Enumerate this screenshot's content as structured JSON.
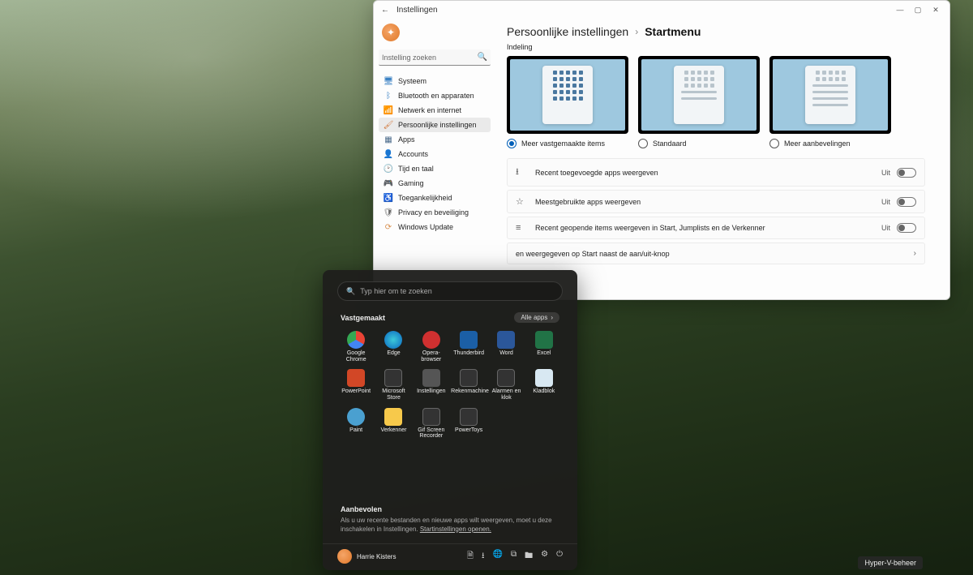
{
  "settings": {
    "back_icon": "←",
    "window_title": "Instellingen",
    "search_placeholder": "Instelling zoeken",
    "nav": [
      {
        "icon": "🖥",
        "label": "Systeem",
        "color": "#3b82c4"
      },
      {
        "icon": "ᛒ",
        "label": "Bluetooth en apparaten",
        "color": "#3b82c4"
      },
      {
        "icon": "📶",
        "label": "Netwerk en internet",
        "color": "#3bb0d4"
      },
      {
        "icon": "🖌",
        "label": "Persoonlijke instellingen",
        "color": "#d07030",
        "selected": true
      },
      {
        "icon": "▦",
        "label": "Apps",
        "color": "#4a6a8a"
      },
      {
        "icon": "👤",
        "label": "Accounts",
        "color": "#d89050"
      },
      {
        "icon": "🕑",
        "label": "Tijd en taal",
        "color": "#6a6a6a"
      },
      {
        "icon": "🎮",
        "label": "Gaming",
        "color": "#6a6a6a"
      },
      {
        "icon": "♿",
        "label": "Toegankelijkheid",
        "color": "#3b82c4"
      },
      {
        "icon": "🛡",
        "label": "Privacy en beveiliging",
        "color": "#6a6a6a"
      },
      {
        "icon": "⟳",
        "label": "Windows Update",
        "color": "#d89050"
      }
    ],
    "breadcrumb": {
      "parent": "Persoonlijke instellingen",
      "sep": "›",
      "current": "Startmenu"
    },
    "section_layout": "Indeling",
    "layout_options": [
      {
        "label": "Meer vastgemaakte items",
        "checked": true
      },
      {
        "label": "Standaard",
        "checked": false
      },
      {
        "label": "Meer aanbevelingen",
        "checked": false
      }
    ],
    "toggles": [
      {
        "icon": "⭳",
        "label": "Recent toegevoegde apps weergeven",
        "state": "Uit"
      },
      {
        "icon": "☆",
        "label": "Meestgebruikte apps weergeven",
        "state": "Uit"
      },
      {
        "icon": "≡",
        "label": "Recent geopende items weergeven in Start, Jumplists en de Verkenner",
        "state": "Uit"
      }
    ],
    "expand_row": "en weergegeven op Start naast de aan/uit-knop"
  },
  "start": {
    "search_placeholder": "Typ hier om te zoeken",
    "pinned_label": "Vastgemaakt",
    "all_apps": "Alle apps",
    "apps": [
      {
        "label": "Google Chrome",
        "cls": "ic-chrome"
      },
      {
        "label": "Edge",
        "cls": "ic-edge"
      },
      {
        "label": "Opera-browser",
        "cls": "ic-opera"
      },
      {
        "label": "Thunderbird",
        "cls": "ic-tbird"
      },
      {
        "label": "Word",
        "cls": "ic-word"
      },
      {
        "label": "Excel",
        "cls": "ic-excel"
      },
      {
        "label": "PowerPoint",
        "cls": "ic-ppt"
      },
      {
        "label": "Microsoft Store",
        "cls": "ic-store"
      },
      {
        "label": "Instellingen",
        "cls": "ic-settings"
      },
      {
        "label": "Rekenmachine",
        "cls": "ic-calc"
      },
      {
        "label": "Alarmen en klok",
        "cls": "ic-clock"
      },
      {
        "label": "Kladblok",
        "cls": "ic-notepad"
      },
      {
        "label": "Paint",
        "cls": "ic-paint"
      },
      {
        "label": "Verkenner",
        "cls": "ic-explorer"
      },
      {
        "label": "Gif Screen Recorder",
        "cls": "ic-gif"
      },
      {
        "label": "PowerToys",
        "cls": "ic-ptoys"
      }
    ],
    "recommended_label": "Aanbevolen",
    "recommended_desc_prefix": "Als u uw recente bestanden en nieuwe apps wilt weergeven, moet u deze inschakelen in Instellingen. ",
    "recommended_link": "Startinstellingen openen.",
    "user_name": "Harrie Kisters",
    "tray_icons": [
      "🗎",
      "⭳",
      "🌐",
      "⧉",
      "🖿",
      "⚙",
      "⏻"
    ]
  },
  "taskbar_label": "Hyper-V-beheer"
}
